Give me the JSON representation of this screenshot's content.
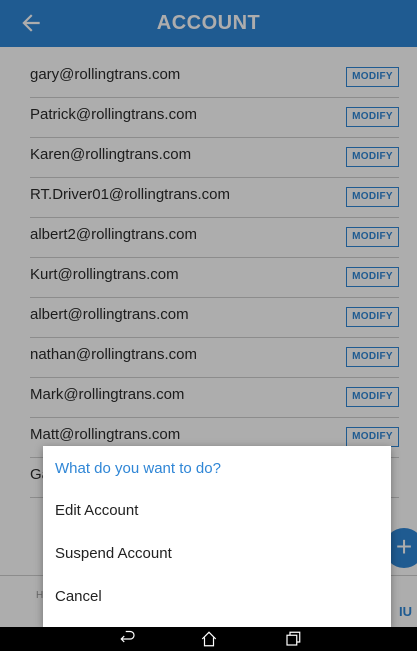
{
  "header": {
    "title": "ACCOUNT",
    "back_icon": "arrow-left-icon"
  },
  "accounts": [
    {
      "email": "gary@rollingtrans.com",
      "action": "MODIFY"
    },
    {
      "email": "Patrick@rollingtrans.com",
      "action": "MODIFY"
    },
    {
      "email": "Karen@rollingtrans.com",
      "action": "MODIFY"
    },
    {
      "email": "RT.Driver01@rollingtrans.com",
      "action": "MODIFY"
    },
    {
      "email": "albert2@rollingtrans.com",
      "action": "MODIFY"
    },
    {
      "email": "Kurt@rollingtrans.com",
      "action": "MODIFY"
    },
    {
      "email": "albert@rollingtrans.com",
      "action": "MODIFY"
    },
    {
      "email": "nathan@rollingtrans.com",
      "action": "MODIFY"
    },
    {
      "email": "Mark@rollingtrans.com",
      "action": "MODIFY"
    },
    {
      "email": "Matt@rollingtrans.com",
      "action": "MODIFY"
    },
    {
      "email": "Ga",
      "action": ""
    }
  ],
  "fab": {
    "label": "+"
  },
  "bottom_menu": {
    "label": "IU"
  },
  "bottom_hint": {
    "label": "H"
  },
  "dialog": {
    "title": "What do you want to do?",
    "options": [
      "Edit Account",
      "Suspend Account",
      "Cancel"
    ]
  },
  "navbar": {
    "back_icon": "nav-back-icon",
    "home_icon": "nav-home-icon",
    "recents_icon": "nav-recents-icon"
  },
  "colors": {
    "primary": "#2f86d6",
    "navbar": "#000000"
  }
}
